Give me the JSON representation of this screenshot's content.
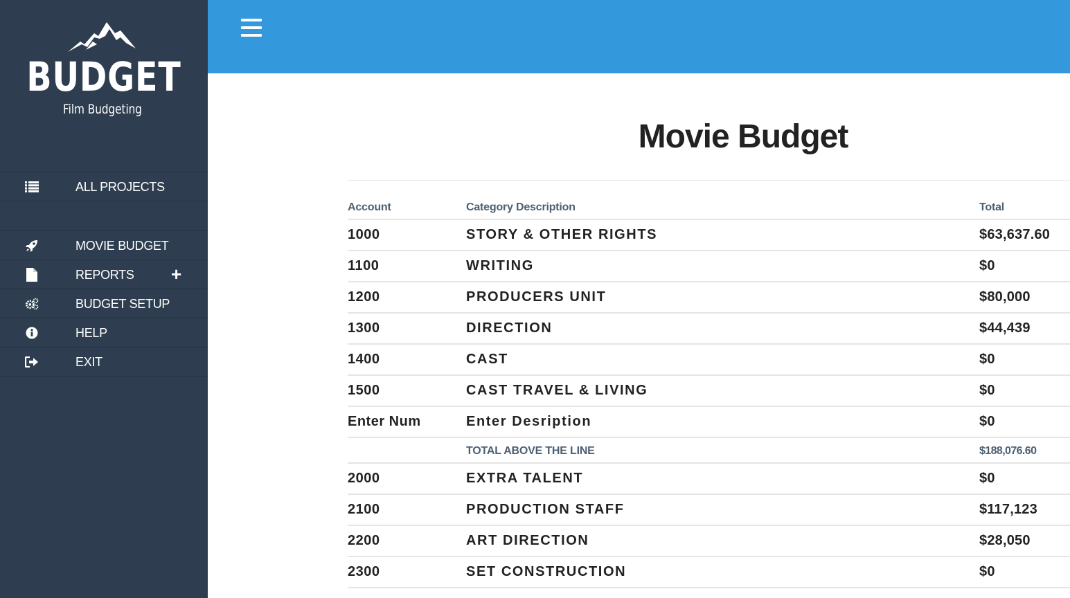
{
  "brand": {
    "name": "BUDGET",
    "tagline": "Film Budgeting"
  },
  "sidebar": {
    "items": [
      {
        "label": "ALL PROJECTS",
        "icon": "list-icon"
      },
      {
        "label": "MOVIE BUDGET",
        "icon": "rocket-icon"
      },
      {
        "label": "REPORTS",
        "icon": "file-icon",
        "expand": "+"
      },
      {
        "label": "BUDGET SETUP",
        "icon": "gears-icon"
      },
      {
        "label": "HELP",
        "icon": "info-icon"
      },
      {
        "label": "EXIT",
        "icon": "sign-out-icon"
      }
    ]
  },
  "topbar": {
    "menu_icon": "hamburger-icon",
    "color": "#3498dc"
  },
  "main": {
    "title": "Movie Budget",
    "columns": {
      "account": "Account",
      "description": "Category Description",
      "total": "Total"
    },
    "rows": [
      {
        "account": "1000",
        "description": "STORY & OTHER RIGHTS",
        "total": "$63,637.60"
      },
      {
        "account": "1100",
        "description": "WRITING",
        "total": "$0"
      },
      {
        "account": "1200",
        "description": "PRODUCERS UNIT",
        "total": "$80,000"
      },
      {
        "account": "1300",
        "description": "DIRECTION",
        "total": "$44,439"
      },
      {
        "account": "1400",
        "description": "CAST",
        "total": "$0"
      },
      {
        "account": "1500",
        "description": "CAST TRAVEL & LIVING",
        "total": "$0"
      },
      {
        "account": "Enter Num",
        "description": "Enter Desription",
        "total": "$0"
      },
      {
        "account": "",
        "description": "TOTAL ABOVE THE LINE",
        "total": "$188,076.60"
      },
      {
        "account": "2000",
        "description": "EXTRA TALENT",
        "total": "$0"
      },
      {
        "account": "2100",
        "description": "PRODUCTION STAFF",
        "total": "$117,123"
      },
      {
        "account": "2200",
        "description": "ART DIRECTION",
        "total": "$28,050"
      },
      {
        "account": "2300",
        "description": "SET CONSTRUCTION",
        "total": "$0"
      }
    ]
  },
  "colors": {
    "sidebar_bg": "#2e3e50",
    "accent": "#3498dc",
    "subtotal_text": "#4c6072"
  }
}
